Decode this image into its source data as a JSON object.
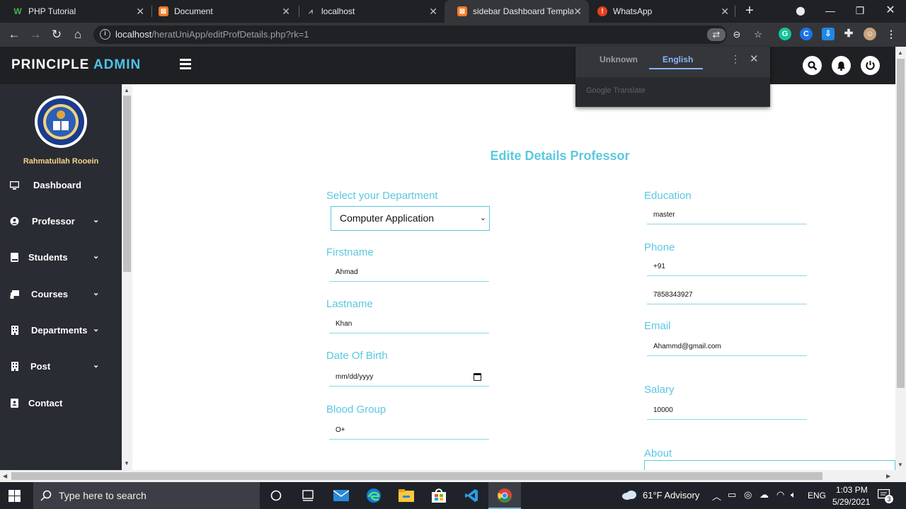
{
  "browser": {
    "tabs": [
      {
        "title": "PHP Tutorial",
        "icon": "w3schools-icon"
      },
      {
        "title": "Document",
        "icon": "xampp-icon"
      },
      {
        "title": "localhost",
        "icon": "page-icon"
      },
      {
        "title": "sidebar Dashboard Template",
        "icon": "xampp-icon",
        "active": true
      },
      {
        "title": "WhatsApp",
        "icon": "whatsapp-icon"
      }
    ],
    "url_host": "localhost",
    "url_path": "/heratUniApp/editProfDetails.php?rk=1"
  },
  "translate_popup": {
    "source_lang": "Unknown",
    "target_lang": "English",
    "footer": "Google Translate"
  },
  "app": {
    "brand_left": "PRINCIPLE",
    "brand_right": "ADMIN",
    "accent_color": "#4fc3e8"
  },
  "sidebar": {
    "user_name": "Rahmatullah Rooein",
    "items": [
      {
        "label": "Dashboard",
        "icon": "monitor-icon",
        "has_submenu": false
      },
      {
        "label": "Professor",
        "icon": "user-circle-icon",
        "has_submenu": true
      },
      {
        "label": "Students",
        "icon": "book-icon",
        "has_submenu": true
      },
      {
        "label": "Courses",
        "icon": "chalkboard-icon",
        "has_submenu": true
      },
      {
        "label": "Departments",
        "icon": "building-icon",
        "has_submenu": true
      },
      {
        "label": "Post",
        "icon": "building-icon",
        "has_submenu": true
      },
      {
        "label": "Contact",
        "icon": "contact-card-icon",
        "has_submenu": false
      }
    ]
  },
  "form": {
    "title": "Edite Details Professor",
    "department": {
      "label": "Select your Department",
      "value": "Computer Application"
    },
    "firstname": {
      "label": "Firstname",
      "value": "Ahmad"
    },
    "lastname": {
      "label": "Lastname",
      "value": "Khan"
    },
    "dob": {
      "label": "Date Of Birth",
      "value": "mm/dd/yyyy"
    },
    "blood_group": {
      "label": "Blood Group",
      "value": "O+"
    },
    "education": {
      "label": "Education",
      "value": "master"
    },
    "phone": {
      "label": "Phone",
      "code": "+91",
      "number": "7858343927"
    },
    "email": {
      "label": "Email",
      "value": "Ahammd@gmail.com"
    },
    "salary": {
      "label": "Salary",
      "value": "10000"
    },
    "about": {
      "label": "About"
    }
  },
  "taskbar": {
    "search_placeholder": "Type here to search",
    "weather": "61°F  Advisory",
    "lang": "ENG",
    "time": "1:03 PM",
    "date": "5/29/2021",
    "notifications": "3"
  }
}
